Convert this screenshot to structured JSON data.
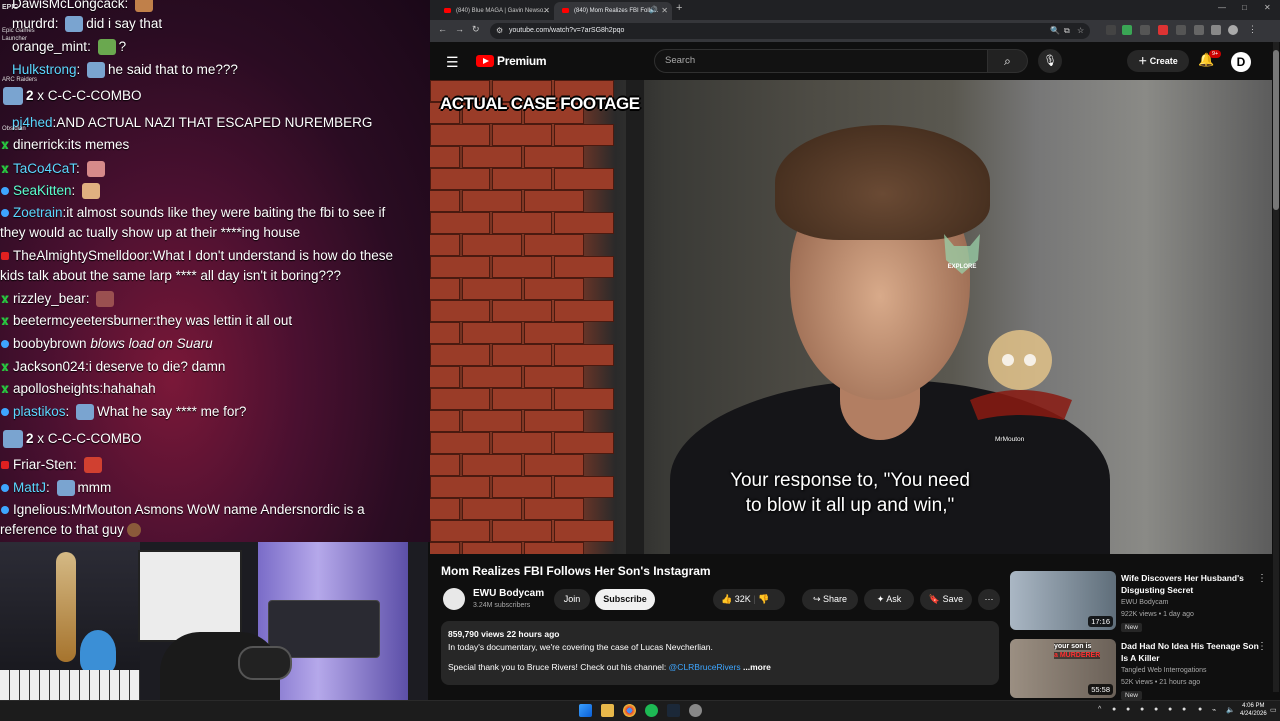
{
  "chat": {
    "messages": [
      {
        "user": "DawisMcLongcack",
        "text": ":",
        "badge": "none",
        "user_color": "#ffffff"
      },
      {
        "user": "murdrd",
        "text": "did i say that",
        "badge": "none",
        "user_color": "#ffffff"
      },
      {
        "user": "orange_mint",
        "text": "?",
        "badge": "none",
        "user_color": "#ffffff"
      },
      {
        "user": "Hulkstrong",
        "text": "he said that to me???",
        "badge": "none",
        "user_color": "#5cd7ff"
      },
      {
        "combo_count": "2",
        "combo_x": "x",
        "combo_text": "C-C-C-COMBO"
      },
      {
        "user": "pj4hed",
        "text": "AND ACTUAL NAZI THAT ESCAPED NUREMBERG",
        "badge": "none",
        "user_color": "#5cd7ff"
      },
      {
        "user": "dinerrick",
        "text": "its memes",
        "badge": "green",
        "user_color": "#ffffff"
      },
      {
        "user": "TaCo4CaT",
        "text": ":",
        "badge": "green",
        "user_color": "#5cd7ff"
      },
      {
        "user": "SeaKitten",
        "text": ":",
        "badge": "blue",
        "user_color": "#5cffd0"
      },
      {
        "user": "Zoetrain",
        "text": "it almost sounds like they were baiting the fbi to see if",
        "text2": "they would ac tually show up at their ****ing house",
        "badge": "blue",
        "user_color": "#5cd7ff"
      },
      {
        "user": "TheAlmightySmelldoor",
        "text": "What I don't understand is how do these",
        "text2": "kids talk about the same larp **** all day isn't it boring???",
        "badge": "red",
        "user_color": "#ffffff"
      },
      {
        "user": "rizzley_bear",
        "text": ":",
        "badge": "green",
        "user_color": "#ffffff"
      },
      {
        "user": "beetermcyeetersburner",
        "text": "they was lettin it all out",
        "badge": "green",
        "user_color": "#ffffff"
      },
      {
        "user": "boobybrown",
        "text": "blows load on Suaru",
        "badge": "blue",
        "user_color": "#ffffff"
      },
      {
        "user": "Jackson024",
        "text": "i deserve to die? damn",
        "badge": "green",
        "user_color": "#ffffff"
      },
      {
        "user": "apollosheights",
        "text": "hahahah",
        "badge": "green",
        "user_color": "#ffffff"
      },
      {
        "user": "plastikos",
        "text": "What he say **** me for?",
        "badge": "blue",
        "user_color": "#5cd7ff"
      },
      {
        "combo_count": "2",
        "combo_x": "x",
        "combo_text": "C-C-C-COMBO"
      },
      {
        "user": "Friar-Sten",
        "text": ":",
        "badge": "red",
        "user_color": "#ffffff"
      },
      {
        "user": "MattJ",
        "text": "mmm",
        "badge": "blue",
        "user_color": "#5cd7ff"
      },
      {
        "user": "Ignelious",
        "text": "MrMouton Asmons WoW name Andersnordic is a",
        "text2": "reference to that guy",
        "badge": "blue",
        "user_color": "#ffffff"
      }
    ],
    "side_tags": [
      "EPIC",
      "Epic Games",
      "Launcher",
      "ARC Raiders",
      "Obsidian"
    ]
  },
  "browser": {
    "tabs": [
      {
        "label": "(840) Blue MAGA | Gavin Newso..."
      },
      {
        "label": "(840) Mom Realizes FBI Follo..."
      }
    ],
    "url": "youtube.com/watch?v=7arSG8h2pqo",
    "new_tab_glyph": "+",
    "win_controls": [
      "—",
      "□",
      "✕"
    ]
  },
  "youtube": {
    "brand": "Premium",
    "search_placeholder": "Search",
    "create_label": "Create",
    "notif_badge": "9+",
    "video": {
      "overlay_title": "ACTUAL CASE FOOTAGE",
      "subtitle_line1": "Your response to, \"You need",
      "subtitle_line2": "to blow it all up and win,\"",
      "mascot_name": "MrMouton",
      "explore_text": "EXPLORE"
    },
    "title": "Mom Realizes FBI Follows Her Son's Instagram",
    "channel": "EWU Bodycam",
    "subscribers": "3.24M subscribers",
    "join_label": "Join",
    "subscribe_label": "Subscribe",
    "likes": "32K",
    "share_label": "Share",
    "ask_label": "Ask",
    "save_label": "Save",
    "description": {
      "meta": "859,790 views  22 hours ago",
      "line1": "In today's documentary, we're covering the case of Lucas Nevcherlian.",
      "line2": "Special thank you to Bruce Rivers! Check out his channel:",
      "link": "@CLRBruceRivers",
      "more": "...more"
    },
    "recommendations": [
      {
        "title": "Wife Discovers Her Husband's Disgusting Secret",
        "channel": "EWU Bodycam",
        "meta": "922K views • 1 day ago",
        "duration": "17:16",
        "badge": "New"
      },
      {
        "title": "Dad Had No Idea His Teenage Son Is A Killer",
        "channel": "Tangled Web Interrogations",
        "meta": "52K views • 21 hours ago",
        "duration": "55:58",
        "badge": "New",
        "thumb_text1": "your son is",
        "thumb_text2": "a MURDERER"
      }
    ]
  },
  "taskbar": {
    "time": "4:06 PM",
    "date": "4/24/2026"
  },
  "colors": {
    "youtube_red": "#ff0000",
    "link_blue": "#3ea6ff",
    "chat_accent": "#5cd7ff"
  }
}
